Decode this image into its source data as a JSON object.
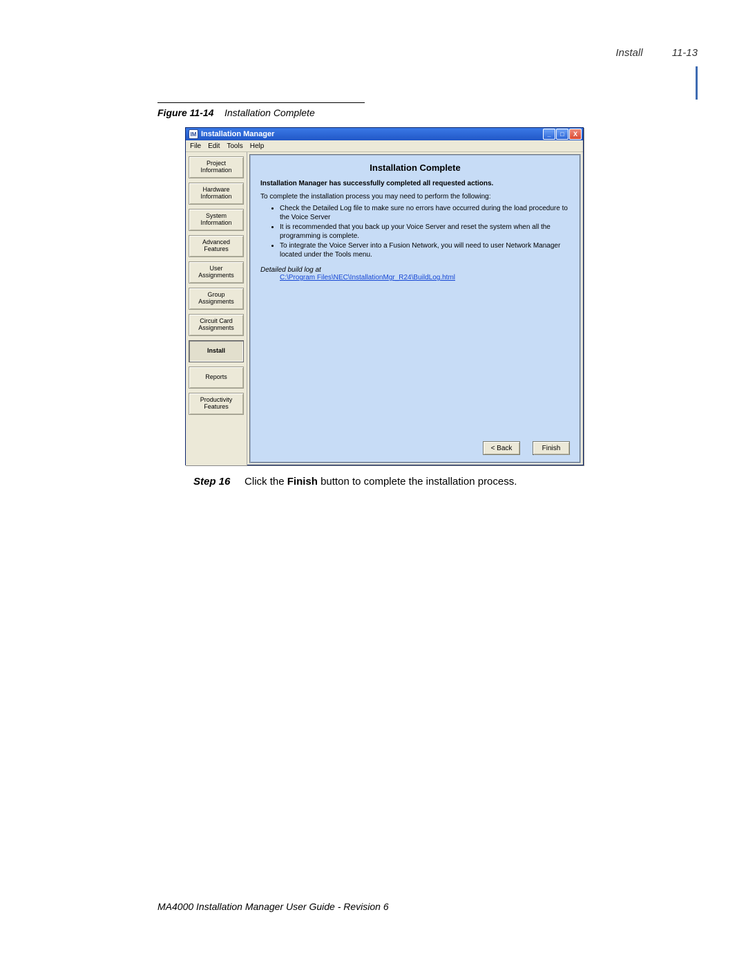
{
  "header": {
    "section": "Install",
    "page": "11-13"
  },
  "figure": {
    "label": "Figure 11-14",
    "title": "Installation Complete"
  },
  "window": {
    "title": "Installation Manager",
    "icon_text": "IM",
    "controls": {
      "min": "_",
      "max": "□",
      "close": "X"
    }
  },
  "menu": {
    "items": [
      "File",
      "Edit",
      "Tools",
      "Help"
    ]
  },
  "sidebar": {
    "items": [
      {
        "label": "Project\nInformation",
        "active": false
      },
      {
        "label": "Hardware\nInformation",
        "active": false
      },
      {
        "label": "System\nInformation",
        "active": false
      },
      {
        "label": "Advanced\nFeatures",
        "active": false
      },
      {
        "label": "User\nAssignments",
        "active": false
      },
      {
        "label": "Group\nAssignments",
        "active": false
      },
      {
        "label": "Circuit Card\nAssignments",
        "active": false
      },
      {
        "label": "Install",
        "active": true
      },
      {
        "label": "Reports",
        "active": false
      },
      {
        "label": "Productivity\nFeatures",
        "active": false
      }
    ]
  },
  "content": {
    "title": "Installation Complete",
    "success": "Installation Manager has successfully completed all requested actions.",
    "intro": "To complete the installation process you may need to perform the following:",
    "bullets": [
      "Check the Detailed Log file to make sure no errors have occurred during the load procedure to the Voice Server",
      "It is recommended that you back up your Voice Server and reset the system when all the programming is complete.",
      "To integrate the Voice Server into a Fusion Network, you will need to user Network Manager located under the Tools menu."
    ],
    "log_heading": "Detailed build log at",
    "log_link": "C:\\Program Files\\NEC\\InstallationMgr_R24\\BuildLog.html",
    "buttons": {
      "back": "< Back",
      "finish": "Finish"
    }
  },
  "step": {
    "label": "Step  16",
    "before": "Click the ",
    "bold": "Finish",
    "after": " button to complete the installation process."
  },
  "footer": "MA4000 Installation Manager User Guide - Revision 6"
}
